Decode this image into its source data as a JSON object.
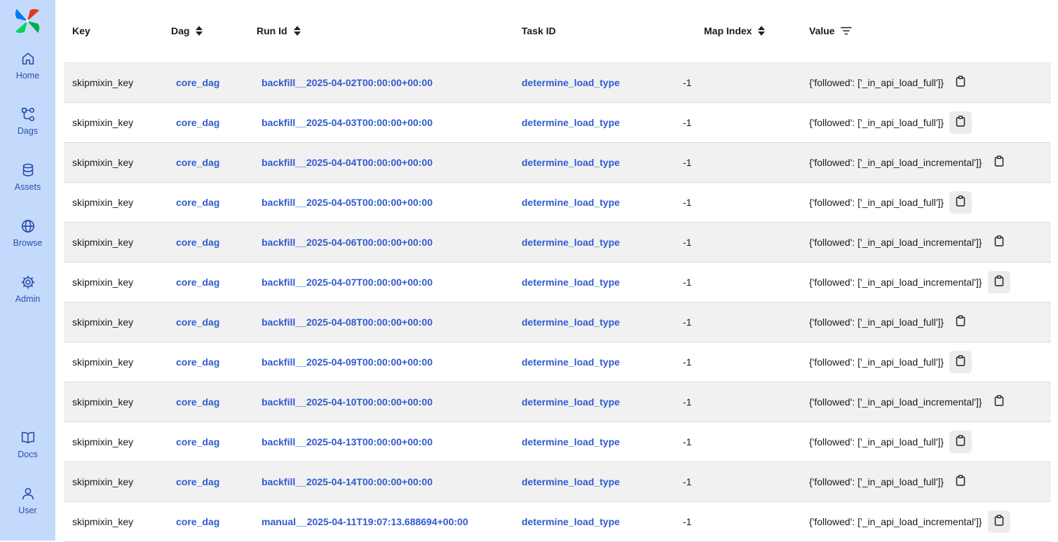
{
  "sidebar": {
    "items": [
      {
        "label": "Home",
        "icon": "home-icon"
      },
      {
        "label": "Dags",
        "icon": "dags-icon"
      },
      {
        "label": "Assets",
        "icon": "database-icon"
      },
      {
        "label": "Browse",
        "icon": "globe-icon"
      },
      {
        "label": "Admin",
        "icon": "gear-icon"
      }
    ],
    "bottom_items": [
      {
        "label": "Docs",
        "icon": "book-icon"
      },
      {
        "label": "User",
        "icon": "user-icon"
      }
    ]
  },
  "table": {
    "headers": {
      "key": "Key",
      "dag": "Dag",
      "run_id": "Run Id",
      "task_id": "Task ID",
      "map_index": "Map Index",
      "value": "Value"
    },
    "rows": [
      {
        "key": "skipmixin_key",
        "dag": "core_dag",
        "run_id": "backfill__2025-04-02T00:00:00+00:00",
        "task_id": "determine_load_type",
        "map_index": "-1",
        "value": "{'followed': ['_in_api_load_full']}"
      },
      {
        "key": "skipmixin_key",
        "dag": "core_dag",
        "run_id": "backfill__2025-04-03T00:00:00+00:00",
        "task_id": "determine_load_type",
        "map_index": "-1",
        "value": "{'followed': ['_in_api_load_full']}"
      },
      {
        "key": "skipmixin_key",
        "dag": "core_dag",
        "run_id": "backfill__2025-04-04T00:00:00+00:00",
        "task_id": "determine_load_type",
        "map_index": "-1",
        "value": "{'followed': ['_in_api_load_incremental']}"
      },
      {
        "key": "skipmixin_key",
        "dag": "core_dag",
        "run_id": "backfill__2025-04-05T00:00:00+00:00",
        "task_id": "determine_load_type",
        "map_index": "-1",
        "value": "{'followed': ['_in_api_load_full']}"
      },
      {
        "key": "skipmixin_key",
        "dag": "core_dag",
        "run_id": "backfill__2025-04-06T00:00:00+00:00",
        "task_id": "determine_load_type",
        "map_index": "-1",
        "value": "{'followed': ['_in_api_load_incremental']}"
      },
      {
        "key": "skipmixin_key",
        "dag": "core_dag",
        "run_id": "backfill__2025-04-07T00:00:00+00:00",
        "task_id": "determine_load_type",
        "map_index": "-1",
        "value": "{'followed': ['_in_api_load_incremental']}"
      },
      {
        "key": "skipmixin_key",
        "dag": "core_dag",
        "run_id": "backfill__2025-04-08T00:00:00+00:00",
        "task_id": "determine_load_type",
        "map_index": "-1",
        "value": "{'followed': ['_in_api_load_full']}"
      },
      {
        "key": "skipmixin_key",
        "dag": "core_dag",
        "run_id": "backfill__2025-04-09T00:00:00+00:00",
        "task_id": "determine_load_type",
        "map_index": "-1",
        "value": "{'followed': ['_in_api_load_full']}"
      },
      {
        "key": "skipmixin_key",
        "dag": "core_dag",
        "run_id": "backfill__2025-04-10T00:00:00+00:00",
        "task_id": "determine_load_type",
        "map_index": "-1",
        "value": "{'followed': ['_in_api_load_incremental']}"
      },
      {
        "key": "skipmixin_key",
        "dag": "core_dag",
        "run_id": "backfill__2025-04-13T00:00:00+00:00",
        "task_id": "determine_load_type",
        "map_index": "-1",
        "value": "{'followed': ['_in_api_load_full']}"
      },
      {
        "key": "skipmixin_key",
        "dag": "core_dag",
        "run_id": "backfill__2025-04-14T00:00:00+00:00",
        "task_id": "determine_load_type",
        "map_index": "-1",
        "value": "{'followed': ['_in_api_load_full']}"
      },
      {
        "key": "skipmixin_key",
        "dag": "core_dag",
        "run_id": "manual__2025-04-11T19:07:13.688694+00:00",
        "task_id": "determine_load_type",
        "map_index": "-1",
        "value": "{'followed': ['_in_api_load_incremental']}"
      }
    ]
  },
  "colors": {
    "sidebar_bg": "#c4dafc",
    "link": "#2f5bd0",
    "row_stripe": "#f1f1f1"
  }
}
